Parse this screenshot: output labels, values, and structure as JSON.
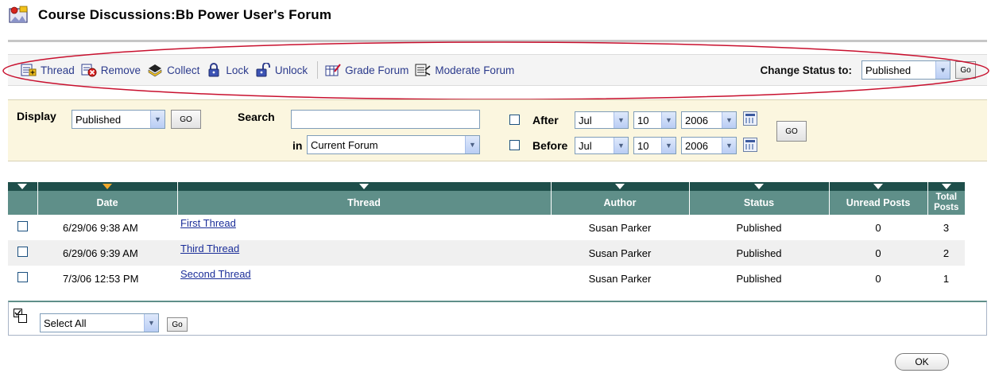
{
  "page": {
    "title": "Course Discussions:Bb Power User's Forum",
    "icon": "forum-icon"
  },
  "toolbar": {
    "items": [
      {
        "label": "Thread",
        "icon": "thread-icon"
      },
      {
        "label": "Remove",
        "icon": "remove-icon"
      },
      {
        "label": "Collect",
        "icon": "collect-icon"
      },
      {
        "label": "Lock",
        "icon": "lock-icon"
      },
      {
        "label": "Unlock",
        "icon": "unlock-icon"
      },
      {
        "label": "Grade Forum",
        "icon": "grade-forum-icon"
      },
      {
        "label": "Moderate Forum",
        "icon": "moderate-forum-icon"
      }
    ],
    "change_status_label": "Change Status to:",
    "status_value": "Published",
    "go_label": "Go"
  },
  "filter": {
    "display_label": "Display",
    "display_value": "Published",
    "display_go": "GO",
    "search_label": "Search",
    "search_value": "",
    "in_label": "in",
    "in_value": "Current Forum",
    "after_label": "After",
    "before_label": "Before",
    "after": {
      "month": "Jul",
      "day": "10",
      "year": "2006"
    },
    "before": {
      "month": "Jul",
      "day": "10",
      "year": "2006"
    },
    "date_go": "GO"
  },
  "table": {
    "columns": [
      "Date",
      "Thread",
      "Author",
      "Status",
      "Unread Posts",
      "Total Posts"
    ],
    "rows": [
      {
        "date": "6/29/06 9:38 AM",
        "thread": "First Thread",
        "author": "Susan Parker",
        "status": "Published",
        "unread": "0",
        "total": "3"
      },
      {
        "date": "6/29/06 9:39 AM",
        "thread": "Third Thread",
        "author": "Susan Parker",
        "status": "Published",
        "unread": "0",
        "total": "2"
      },
      {
        "date": "7/3/06 12:53 PM",
        "thread": "Second Thread",
        "author": "Susan Parker",
        "status": "Published",
        "unread": "0",
        "total": "1"
      }
    ]
  },
  "bottom": {
    "select_value": "Select All",
    "go_label": "Go"
  },
  "ok_label": "OK",
  "colors": {
    "header_teal": "#5f8f89",
    "header_dark": "#1f4f4b",
    "link_blue": "#1b2e99",
    "filter_bg": "#fbf6df",
    "annotation_red": "#c8102e"
  }
}
